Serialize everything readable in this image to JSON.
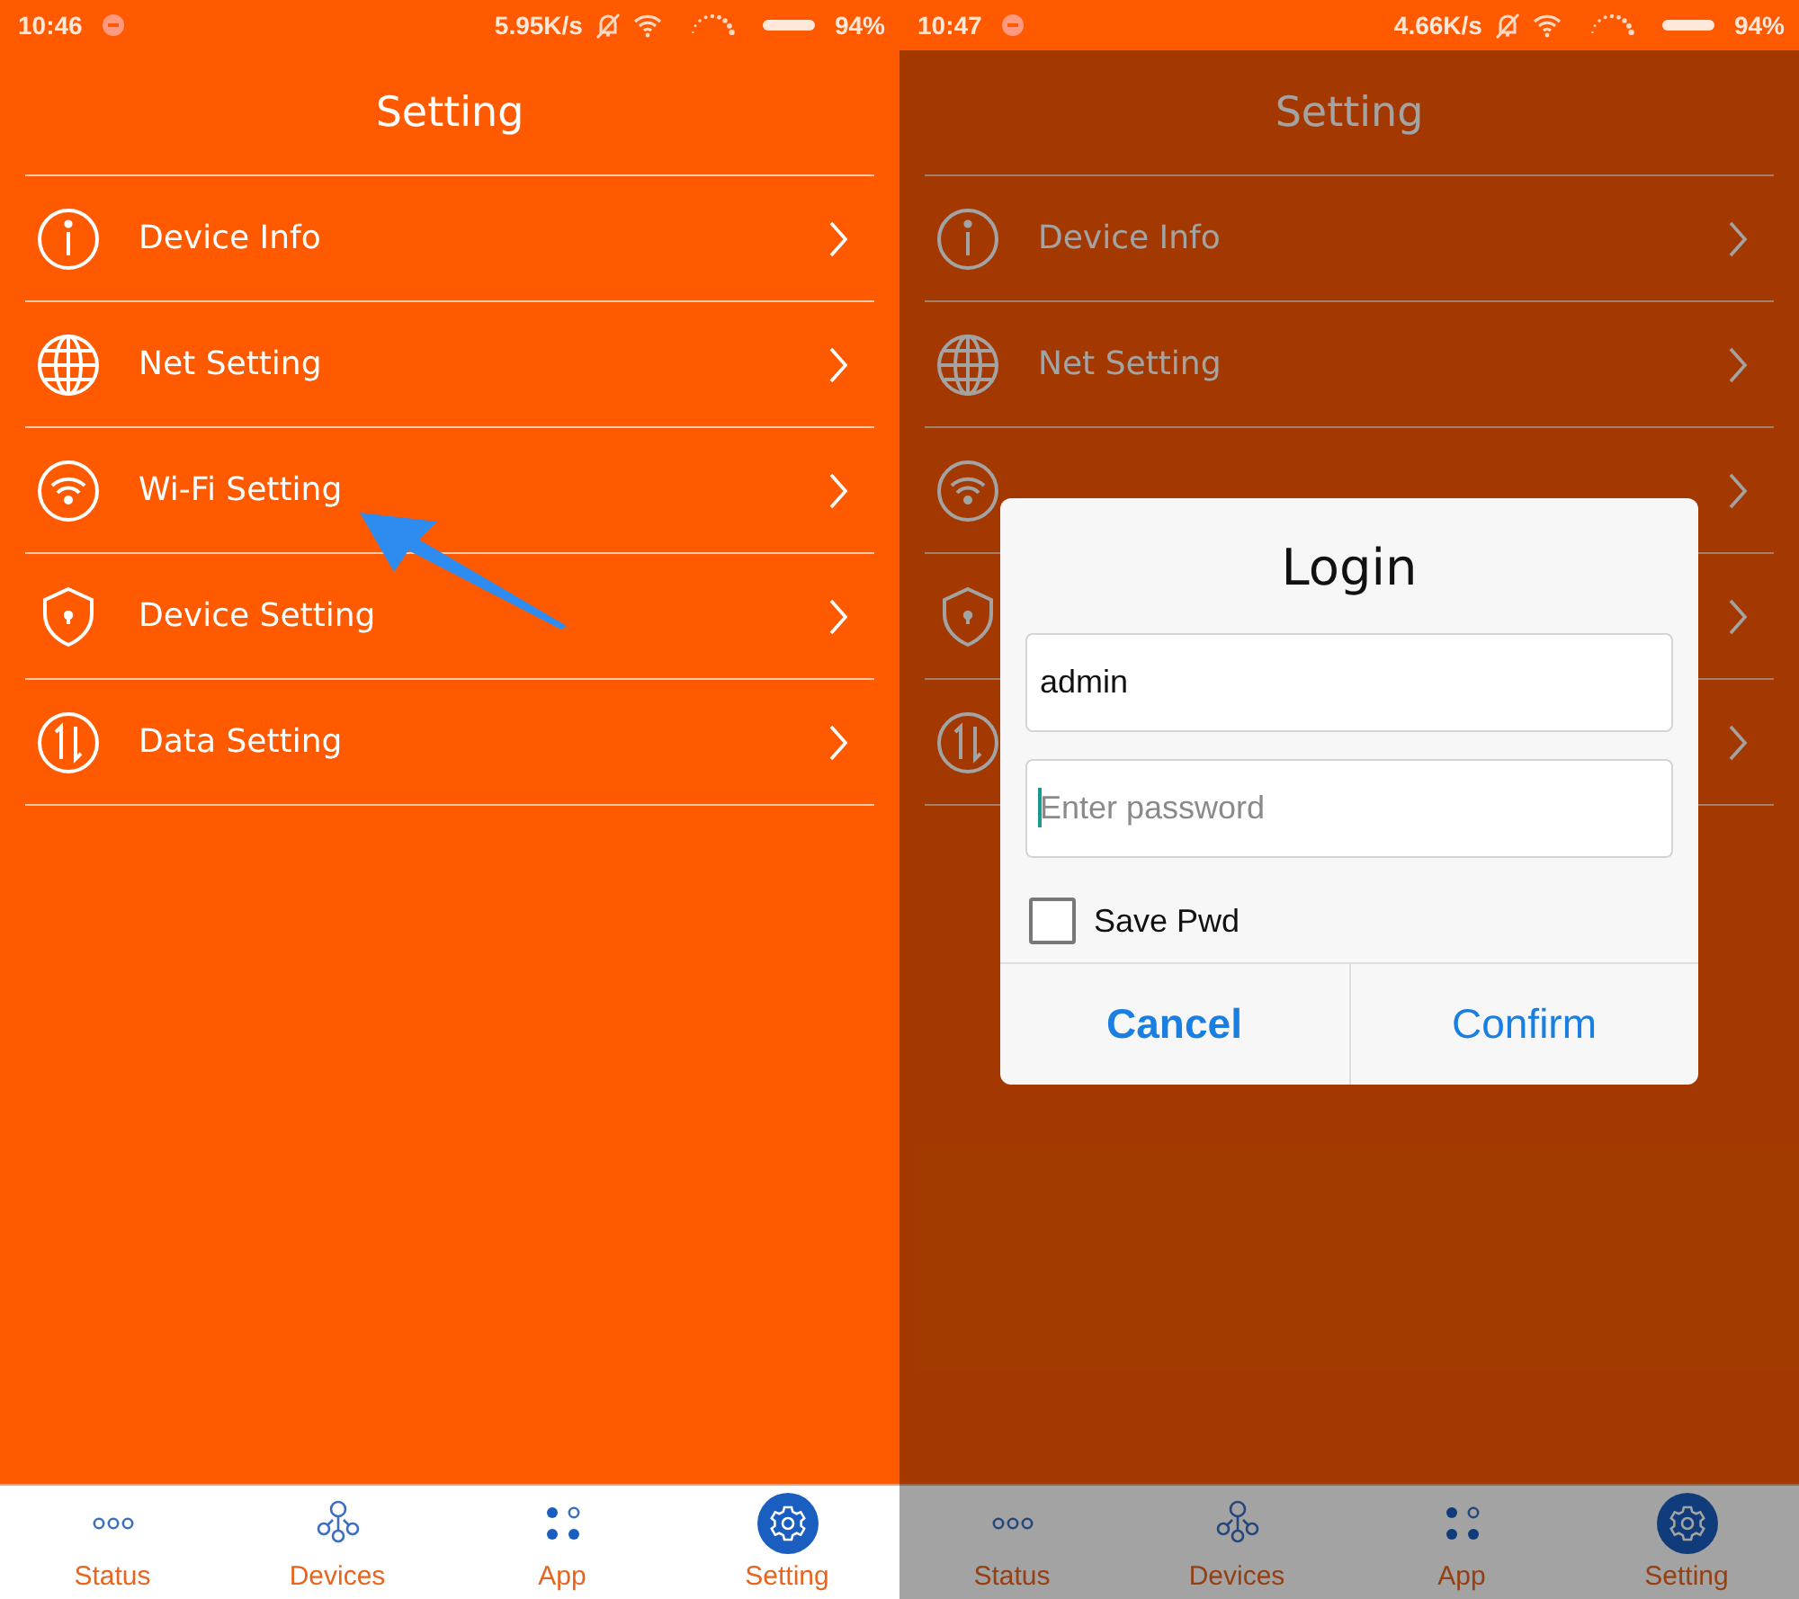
{
  "screens": [
    {
      "status_bar": {
        "time": "10:46",
        "speed": "5.95K/s",
        "battery": "94%"
      },
      "title": "Setting",
      "items": [
        {
          "kind": "info",
          "label": "Device Info"
        },
        {
          "kind": "globe",
          "label": "Net Setting"
        },
        {
          "kind": "wifi",
          "label": "Wi-Fi Setting"
        },
        {
          "kind": "shield",
          "label": "Device Setting"
        },
        {
          "kind": "transfer",
          "label": "Data Setting"
        }
      ],
      "annotation": {
        "kind": "arrow"
      },
      "nav": [
        {
          "kind": "dots",
          "label": "Status",
          "selected": false
        },
        {
          "kind": "network",
          "label": "Devices",
          "selected": false
        },
        {
          "kind": "apps",
          "label": "App",
          "selected": false
        },
        {
          "kind": "gear",
          "label": "Setting",
          "selected": true
        }
      ]
    },
    {
      "status_bar": {
        "time": "10:47",
        "speed": "4.66K/s",
        "battery": "94%"
      },
      "title": "Setting",
      "items": [
        {
          "kind": "info",
          "label": "Device Info"
        },
        {
          "kind": "globe",
          "label": "Net Setting"
        },
        {
          "kind": "wifi"
        },
        {
          "kind": "shield"
        },
        {
          "kind": "transfer"
        }
      ],
      "nav": [
        {
          "kind": "dots",
          "label": "Status",
          "selected": false
        },
        {
          "kind": "network",
          "label": "Devices",
          "selected": false
        },
        {
          "kind": "apps",
          "label": "App",
          "selected": false
        },
        {
          "kind": "gear",
          "label": "Setting",
          "selected": true
        }
      ],
      "dialog": {
        "title": "Login",
        "username": {
          "value": "admin"
        },
        "password": {
          "placeholder": "Enter password"
        },
        "save_pwd": {
          "label": "Save Pwd",
          "checked": false
        },
        "buttons": [
          {
            "kind": "cancel",
            "label": "Cancel"
          },
          {
            "kind": "confirm",
            "label": "Confirm"
          }
        ]
      }
    }
  ]
}
